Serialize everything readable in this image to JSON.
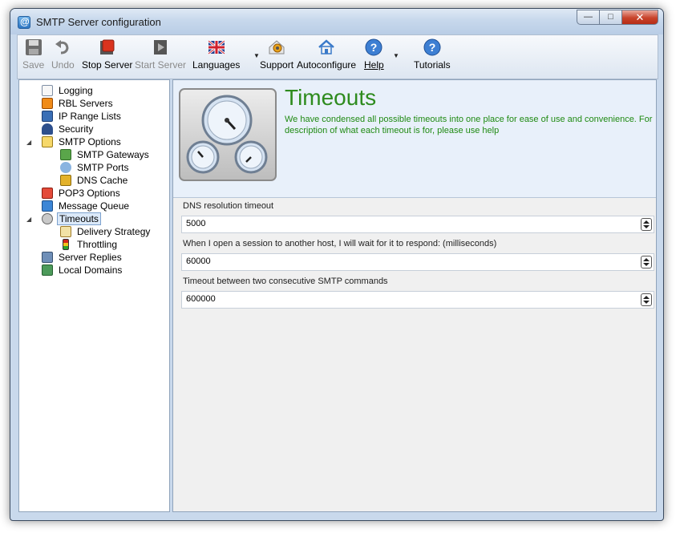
{
  "window": {
    "title": "SMTP Server configuration"
  },
  "toolbar": {
    "save": "Save",
    "undo": "Undo",
    "stop_server": "Stop Server",
    "start_server": "Start Server",
    "languages": "Languages",
    "support": "Support",
    "autoconfigure": "Autoconfigure",
    "help": "Help",
    "tutorials": "Tutorials"
  },
  "nav": {
    "items": [
      {
        "label": "Logging",
        "icon": "log-icon"
      },
      {
        "label": "RBL Servers",
        "icon": "spam-icon"
      },
      {
        "label": "IP Range Lists",
        "icon": "ip-icon"
      },
      {
        "label": "Security",
        "icon": "user-lock-icon"
      },
      {
        "label": "SMTP Options",
        "icon": "mail-options-icon"
      },
      {
        "label": "SMTP Gateways",
        "icon": "gateway-icon"
      },
      {
        "label": "SMTP Ports",
        "icon": "ports-icon"
      },
      {
        "label": "DNS Cache",
        "icon": "cache-icon"
      },
      {
        "label": "POP3 Options",
        "icon": "pop3-icon"
      },
      {
        "label": "Message Queue",
        "icon": "queue-icon"
      },
      {
        "label": "Timeouts",
        "icon": "gauge-icon"
      },
      {
        "label": "Delivery Strategy",
        "icon": "calendar-icon"
      },
      {
        "label": "Throttling",
        "icon": "traffic-light-icon"
      },
      {
        "label": "Server Replies",
        "icon": "replies-icon"
      },
      {
        "label": "Local Domains",
        "icon": "domains-icon"
      }
    ],
    "selected": "Timeouts"
  },
  "page": {
    "title": "Timeouts",
    "description": "We have condensed all possible timeouts into one place for ease of use and convenience. For description of what each  timeout is for, please use help"
  },
  "fields": [
    {
      "label": "DNS resolution timeout",
      "value": "5000"
    },
    {
      "label": "When I open a session to another host, I will wait for it to respond: (milliseconds)",
      "value": "60000"
    },
    {
      "label": "Timeout between two consecutive SMTP commands",
      "value": "600000"
    }
  ],
  "colors": {
    "title_green": "#2e8b1e",
    "desc_green": "#1f8a12",
    "selection": "#dbe9f9"
  }
}
